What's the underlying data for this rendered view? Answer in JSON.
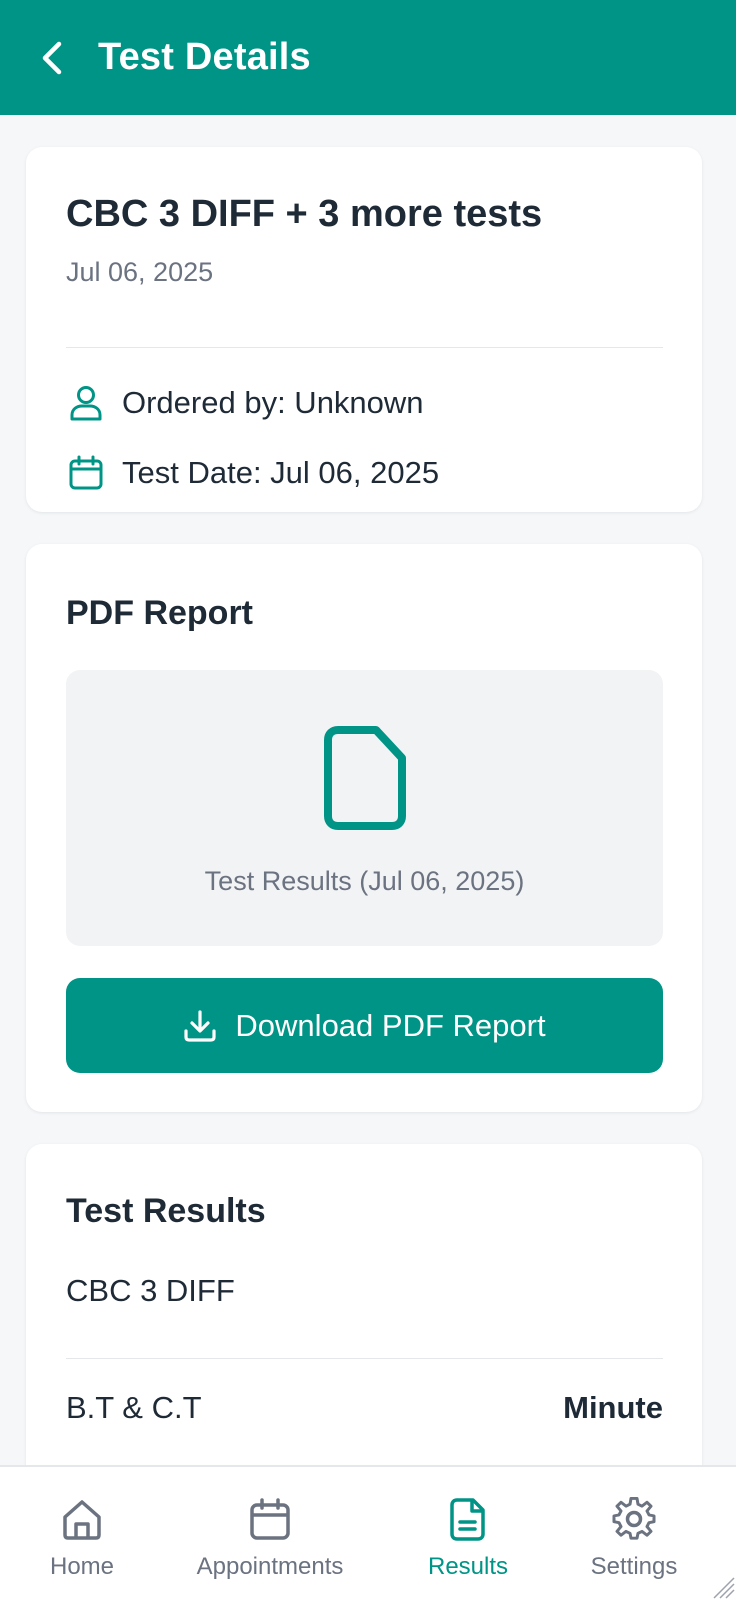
{
  "header": {
    "title": "Test Details",
    "back_icon": "chevron-left-icon"
  },
  "summary": {
    "title": "CBC 3 DIFF + 3 more tests",
    "date": "Jul 06, 2025",
    "ordered_by": "Ordered by: Unknown",
    "test_date": "Test Date: Jul 06, 2025"
  },
  "pdf_report": {
    "title": "PDF Report",
    "file_caption": "Test Results (Jul 06, 2025)",
    "download_label": "Download PDF Report"
  },
  "test_results": {
    "title": "Test Results",
    "rows": [
      {
        "name": "CBC 3 DIFF",
        "value": ""
      },
      {
        "name": "B.T & C.T",
        "value": "Minute"
      }
    ]
  },
  "bottom_nav": {
    "items": [
      {
        "label": "Home",
        "icon": "home-icon",
        "active": false
      },
      {
        "label": "Appointments",
        "icon": "calendar-icon",
        "active": false
      },
      {
        "label": "Results",
        "icon": "document-icon",
        "active": true
      },
      {
        "label": "Settings",
        "icon": "gear-icon",
        "active": false
      }
    ]
  },
  "colors": {
    "primary": "#009486",
    "background": "#F5F7F9",
    "text_primary": "#1F2A37",
    "text_secondary": "#6B7280",
    "inactive_nav": "#6B7280"
  }
}
